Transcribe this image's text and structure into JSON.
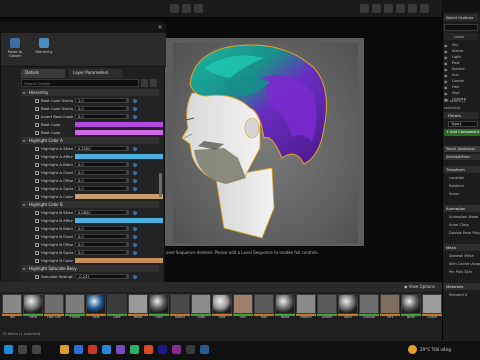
{
  "viewport": {
    "sequence_message": "Level Sequence deleted. Please add a Level Sequence to enable full controls."
  },
  "details_window": {
    "toolbar": [
      {
        "label": "Paste to Groom",
        "icon": "paste-icon"
      },
      {
        "label": "Hierarchy",
        "icon": "hierarchy-icon"
      }
    ],
    "tabs": [
      "Details",
      "Layer Parameters"
    ],
    "search_placeholder": "Search Details",
    "rows": [
      {
        "kind": "cat",
        "label": "Hierarchy"
      },
      {
        "kind": "num",
        "label": "Root Color Strength",
        "value": "1.0"
      },
      {
        "kind": "num",
        "label": "Root Color Strength",
        "value": "0.0"
      },
      {
        "kind": "num",
        "label": "Invert Root mask bias",
        "value": "0.0"
      },
      {
        "kind": "swatch",
        "label": "Root Color",
        "color": "#b14be0"
      },
      {
        "kind": "swatch",
        "label": "Root Color",
        "color": "#d066e8"
      },
      {
        "kind": "cat",
        "label": "Highlight Color A"
      },
      {
        "kind": "num",
        "label": "Highlight A Strength",
        "value": "0.2500"
      },
      {
        "kind": "swatch",
        "label": "Highlight A Affects",
        "color": "#4ab0e0"
      },
      {
        "kind": "num",
        "label": "Highlight A Blend",
        "value": "0.0"
      },
      {
        "kind": "num",
        "label": "Highlight A Overlay",
        "value": "0.0"
      },
      {
        "kind": "num",
        "label": "Highlight A Offset",
        "value": "0.0"
      },
      {
        "kind": "num",
        "label": "Highlight A Spread",
        "value": "0.0"
      },
      {
        "kind": "swatch",
        "label": "Highlight A Color",
        "color": "#c8a070"
      },
      {
        "kind": "cat",
        "label": "Highlight Color B"
      },
      {
        "kind": "num",
        "label": "Highlight B Strength",
        "value": "0.0850"
      },
      {
        "kind": "swatch",
        "label": "Highlight B Affects",
        "color": "#4ab0e0"
      },
      {
        "kind": "num",
        "label": "Highlight B Blend",
        "value": "0.0"
      },
      {
        "kind": "num",
        "label": "Highlight B Overlay",
        "value": "0.0"
      },
      {
        "kind": "num",
        "label": "Highlight B Offset",
        "value": "0.0"
      },
      {
        "kind": "num",
        "label": "Highlight B Spread",
        "value": "0.0"
      },
      {
        "kind": "swatch",
        "label": "Highlight B Color",
        "color": "#c8905c"
      },
      {
        "kind": "cat",
        "label": "Highlight Saturate Bevy"
      },
      {
        "kind": "num",
        "label": "Saturate Strength",
        "value": "-0.237"
      },
      {
        "kind": "num",
        "label": "Width by Blend Bl",
        "value": "-0.269"
      },
      {
        "kind": "num",
        "label": "Relative Horizontal Sp",
        "value": "-0.186"
      },
      {
        "kind": "num",
        "label": "Relative Horizontal Sp",
        "value": "-0.296"
      }
    ]
  },
  "outliner": {
    "tab": "World Outliner",
    "column_label": "Label",
    "rows": [
      "Sky",
      "Atmos",
      "Light",
      "Post",
      "Sphere",
      "Sun",
      "Groom",
      "Hair",
      "Skel",
      "Camera"
    ],
    "actor_count": "16 actors (1 selected)"
  },
  "details_right": {
    "tab": "Details",
    "name_value": "Type1",
    "add_component": "+ Add Component",
    "touch_item": "Touch (Instance)",
    "skeletal_item": "SkeletalMesh",
    "categories": [
      {
        "label": "Transform",
        "props": [
          "Location",
          "Rotation",
          "Scale"
        ]
      },
      {
        "label": "Animation",
        "props": [
          "Animation Mode",
          "Anim Class",
          "Double Pose Play"
        ]
      },
      {
        "label": "Mesh",
        "props": [
          "Skeletal Mesh",
          "Skin Cache Usage",
          "Per Poly Skin"
        ]
      },
      {
        "label": "Materials",
        "props": [
          "Element 0"
        ]
      }
    ]
  },
  "content_browser": {
    "view_options": "View Options",
    "items_count": "13 items (1 selected)",
    "items": [
      {
        "name": "Tex",
        "color": "#888"
      },
      {
        "name": "Hero",
        "color": "#777"
      },
      {
        "name": "Hair Sim",
        "color": "#6e6e6e"
      },
      {
        "name": "Flame",
        "color": "#7c7c7c"
      },
      {
        "name": "Blue",
        "color": "#1e5a9a"
      },
      {
        "name": "Dark",
        "color": "#3b3b3b"
      },
      {
        "name": "Metal",
        "color": "#999"
      },
      {
        "name": "Face",
        "color": "#5d5d5d"
      },
      {
        "name": "Beard",
        "color": "#4a4a4a"
      },
      {
        "name": "Cloth",
        "color": "#8d8d8d"
      },
      {
        "name": "Grid",
        "color": "#9a9a9a"
      },
      {
        "name": "Skin",
        "color": "#a07f6a"
      },
      {
        "name": "Hair",
        "color": "#5a5a5a"
      },
      {
        "name": "Noise",
        "color": "#6c6c6c"
      },
      {
        "name": "Pattern",
        "color": "#8a8a8a"
      },
      {
        "name": "Groom",
        "color": "#5b5b5b"
      },
      {
        "name": "Rock",
        "color": "#777"
      },
      {
        "name": "Ground",
        "color": "#6e6e6e"
      },
      {
        "name": "Dirt",
        "color": "#7e6e5e"
      },
      {
        "name": "Brick",
        "color": "#5e5e5e"
      },
      {
        "name": "Check",
        "color": "#9c9c9c"
      }
    ]
  },
  "taskbar": {
    "weather": "29°C  Trời nắng"
  }
}
